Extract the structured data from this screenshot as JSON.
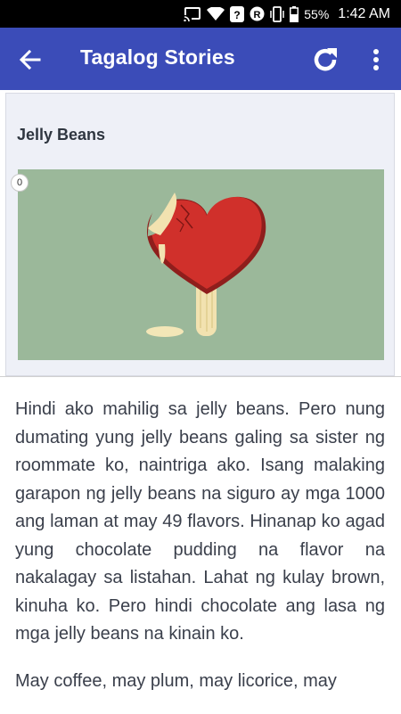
{
  "status_bar": {
    "battery": "55%",
    "time": "1:42 AM",
    "icons": [
      "cast-icon",
      "wifi-icon",
      "nfc-icon",
      "r-badge-icon",
      "vibrate-icon",
      "battery-icon"
    ]
  },
  "app_bar": {
    "title": "Tagalog Stories",
    "back_icon": "arrow-left-icon",
    "refresh_icon": "refresh-icon",
    "menu_icon": "more-vert-icon"
  },
  "story": {
    "title": "Jelly Beans",
    "image_counter": "0",
    "image_subject": "heart-popsicle-illustration",
    "paragraphs": [
      "Hindi ako mahilig sa jelly beans. Pero nung dumating yung jelly beans galing sa sister ng roommate ko, naintriga ako. Isang malaking garapon ng jelly beans na siguro ay mga 1000 ang laman at may 49 flavors. Hinanap ko agad yung chocolate pudding na flavor na nakalagay sa listahan. Lahat ng kulay brown, kinuha ko. Pero hindi chocolate ang lasa ng mga jelly beans na kinain ko.",
      "May coffee, may plum, may licorice, may"
    ]
  },
  "colors": {
    "app_bar": "#3b4cb8",
    "card_bg": "#eef0f7",
    "illustration_bg": "#9bb89a",
    "heart": "#cf2f2a",
    "text": "#3a3f4b"
  }
}
